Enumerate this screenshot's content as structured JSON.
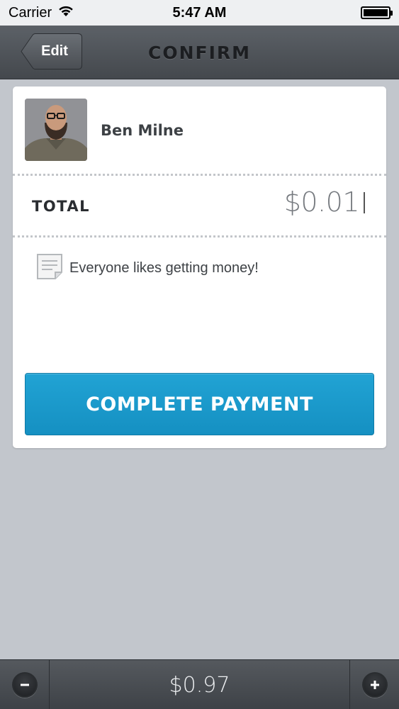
{
  "status_bar": {
    "carrier": "Carrier",
    "time": "5:47 AM",
    "battery_level": 1.0
  },
  "nav": {
    "back_label": "Edit",
    "title": "CONFIRM"
  },
  "recipient": {
    "name": "Ben Milne"
  },
  "total": {
    "label": "TOTAL",
    "value": "$0.01"
  },
  "memo": {
    "icon": "note-icon",
    "text": "Everyone likes getting money!"
  },
  "complete_button": {
    "label": "COMPLETE PAYMENT"
  },
  "bottom_bar": {
    "amount": "$0.97",
    "decrement_icon": "minus-icon",
    "increment_icon": "plus-icon"
  },
  "colors": {
    "accent": "#1a9acc",
    "background": "#c2c6cc",
    "nav_bar": "#4f5358"
  }
}
